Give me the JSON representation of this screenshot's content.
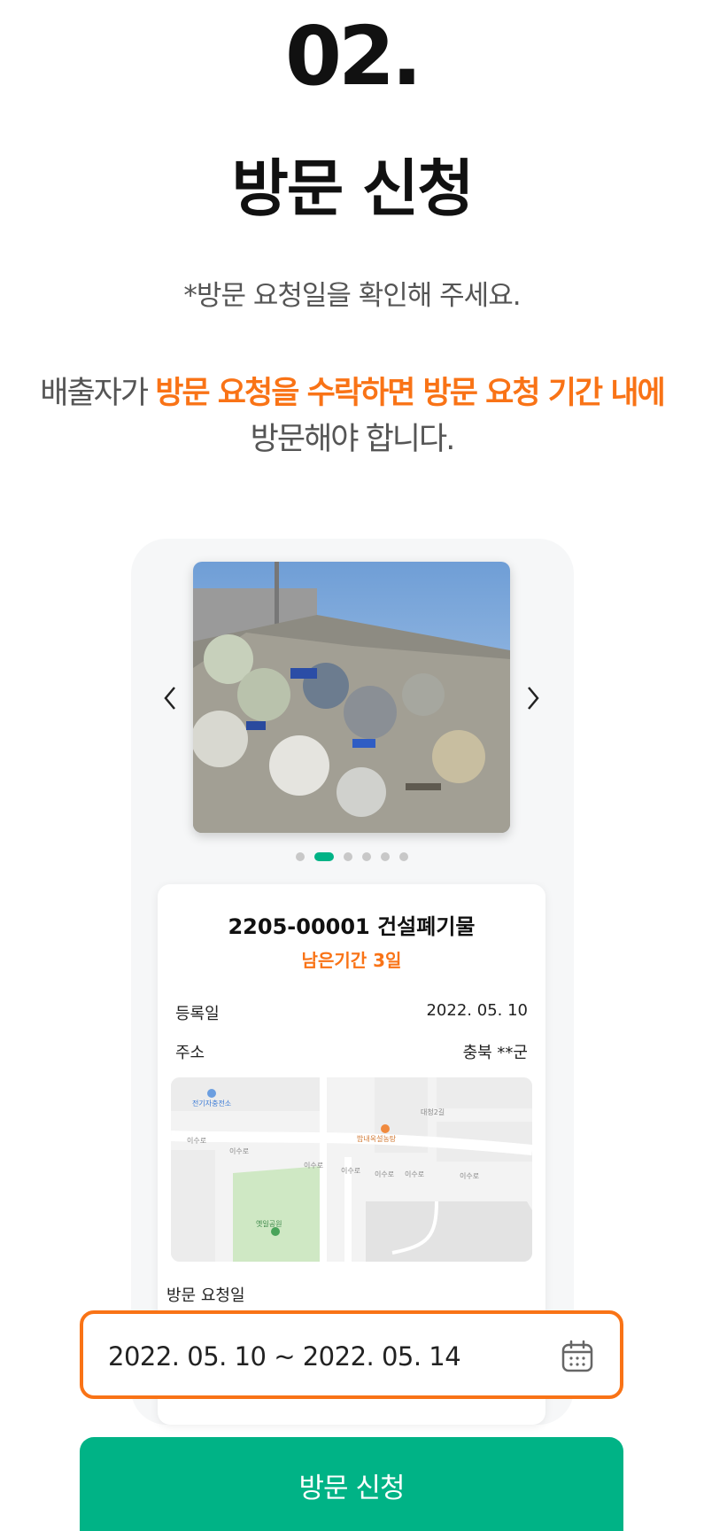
{
  "header": {
    "step_number": "02.",
    "title": "방문 신청",
    "subtitle": "*방문 요청일을 확인해 주세요.",
    "description_prefix": "배출자가 ",
    "description_highlight": "방문 요청을 수락하면 방문 요청 기간 내에",
    "description_suffix": "방문해야 합니다."
  },
  "carousel": {
    "prev_icon": "chevron-left-icon",
    "next_icon": "chevron-right-icon",
    "page_count": 6,
    "active_index": 1
  },
  "card": {
    "title": "2205-00001 건설폐기물",
    "remaining": "남은기간 3일",
    "rows": [
      {
        "label": "등록일",
        "value": "2022. 05. 10"
      },
      {
        "label": "주소",
        "value": "충북 **군"
      }
    ],
    "map_labels": [
      "전기자충전소",
      "대청2길",
      "밥내옥설농탕",
      "이수로",
      "이수로",
      "이수로",
      "이수로",
      "이수로",
      "이수로",
      "이수로",
      "옛일공원"
    ],
    "visit_label": "방문 요청일"
  },
  "date_field": {
    "value": "2022. 05. 10 ~ 2022. 05. 14",
    "icon": "calendar-icon"
  },
  "submit": {
    "label": "방문 신청"
  },
  "colors": {
    "accent_orange": "#f97316",
    "accent_green": "#00b386"
  }
}
